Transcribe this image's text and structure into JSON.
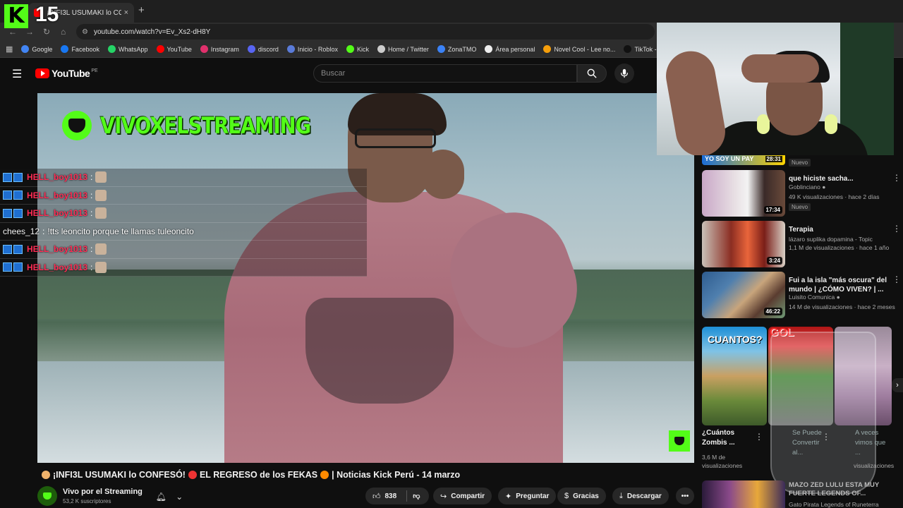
{
  "browser": {
    "tab_title": "¡INFI3L USUMAKI lo CON",
    "tab_close": "×",
    "new_tab": "+",
    "url": "youtube.com/watch?v=Ev_Xs2-dH8Y",
    "bookmarks": [
      {
        "label": "Google",
        "color": "#4285f4"
      },
      {
        "label": "Facebook",
        "color": "#1877f2"
      },
      {
        "label": "WhatsApp",
        "color": "#25d366"
      },
      {
        "label": "YouTube",
        "color": "#ff0000"
      },
      {
        "label": "Instagram",
        "color": "#e1306c"
      },
      {
        "label": "discord",
        "color": "#5865f2"
      },
      {
        "label": "Inicio - Roblox",
        "color": "#5a7bd8"
      },
      {
        "label": "Kick",
        "color": "#53fc18"
      },
      {
        "label": "Home / Twitter",
        "color": "#cccccc"
      },
      {
        "label": "ZonaTMO",
        "color": "#3b82f6"
      },
      {
        "label": "Área personal",
        "color": "#eeeeee"
      },
      {
        "label": "Novel Cool - Lee no...",
        "color": "#f59e0b"
      },
      {
        "label": "TikTok - Alegra tu",
        "color": "#111111"
      }
    ]
  },
  "kick_overlay": {
    "logo_letter": "K",
    "number": "15"
  },
  "youtube": {
    "logo_text": "YouTube",
    "country_code": "PE",
    "search_placeholder": "Buscar"
  },
  "player": {
    "brand_text": "VIVOXELSTREAMING"
  },
  "chat": [
    {
      "user": "HELL_boy1013",
      "sep": ":",
      "msg": "",
      "emote": true,
      "highlight": true
    },
    {
      "user": "HELL_boy1013",
      "sep": ":",
      "msg": "",
      "emote": true,
      "highlight": true
    },
    {
      "user": "HELL_boy1013",
      "sep": ":",
      "msg": "",
      "emote": true,
      "highlight": true
    },
    {
      "user": "chees_12",
      "sep": ":",
      "msg": "!tts leoncito porque te llamas tuleoncito",
      "emote": false,
      "highlight": false
    },
    {
      "user": "HELL_boy1013",
      "sep": ":",
      "msg": "",
      "emote": true,
      "highlight": true
    },
    {
      "user": "HELL_boy1013",
      "sep": ":",
      "msg": "",
      "emote": true,
      "highlight": true
    }
  ],
  "recommendations": {
    "top_partial": {
      "title_fragment": "YO SOY UN PAY",
      "duration": "28:31",
      "badge": "Nuevo"
    },
    "items": [
      {
        "title": "que hiciste sacha...",
        "channel": "Goblinciano",
        "meta": "49 K visualizaciones · hace 2 días",
        "duration": "17:34",
        "badge": "Nuevo"
      },
      {
        "title": "Terapia",
        "channel": "lázaro suplika dopamina - Topic",
        "meta": "1,1 M de visualizaciones · hace 1 año",
        "duration": "3:24",
        "badge": ""
      },
      {
        "title": "Fui a la isla \"más oscura\" del mundo | ¿CÓMO VIVEN? | ...",
        "channel": "Luisito Comunica",
        "meta": "14 M de visualizaciones · hace 2 meses",
        "duration": "46:22",
        "badge": ""
      }
    ]
  },
  "shorts": [
    {
      "thumb_text": "CUANTOS?",
      "title": "¿Cuántos Zombis ...",
      "meta1": "3,6 M de",
      "meta2": "visualizaciones"
    },
    {
      "thumb_text": "GOL",
      "title": "Se Puede Convertir al...",
      "meta1": "",
      "meta2": ""
    },
    {
      "thumb_text": "",
      "title": "A veces vimos que ...",
      "meta1": "",
      "meta2": "visualizaciones"
    }
  ],
  "bottom_rec": {
    "title": "MAZO ZED LULU ESTA MUY FUERTE LEGENDS OF...",
    "channel": "Gato Pirata Legends of Runeterra"
  },
  "video": {
    "title": "¡INFI3L USUMAKI lo CONFESÓ! 😡 EL REGRESO de los FEKAS 🔥 | Noticias Kick Perú - 14 marzo",
    "title_part1": "¡INFI3L USUMAKI lo CONFESÓ!",
    "title_part2": "EL REGRESO de los FEKAS",
    "title_part3": "| Noticias Kick Perú - 14 marzo",
    "channel": "Vivo por el Streaming",
    "subscribers": "53,2 K suscriptores",
    "likes": "838",
    "share_label": "Compartir",
    "ask_label": "Preguntar",
    "thanks_label": "Gracias",
    "download_label": "Descargar",
    "more_label": "•••"
  },
  "colors": {
    "kick_green": "#53fc18",
    "yt_red": "#ff0000",
    "chat_user": "#ff2d55"
  },
  "icons": [
    "menu-icon",
    "search-icon",
    "mic-icon",
    "bell-icon",
    "chevron-down-icon",
    "like-icon",
    "dislike-icon",
    "share-icon",
    "sparkle-icon",
    "thanks-icon",
    "download-icon",
    "more-icon",
    "verified-icon",
    "chevron-right-icon"
  ]
}
